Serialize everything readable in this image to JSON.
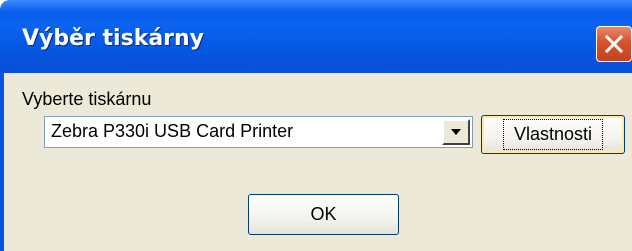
{
  "dialog": {
    "title": "Výběr tiskárny",
    "close_icon": "close-icon",
    "close_color": "#d6542c",
    "titlebar_color": "#0a5ae8",
    "client_color": "#ece9d8"
  },
  "printer": {
    "label": "Vyberte tiskárnu",
    "selected": "Zebra P330i USB Card Printer",
    "dropdown_icon": "chevron-down-icon"
  },
  "buttons": {
    "properties_label": "Vlastnosti",
    "ok_label": "OK"
  }
}
